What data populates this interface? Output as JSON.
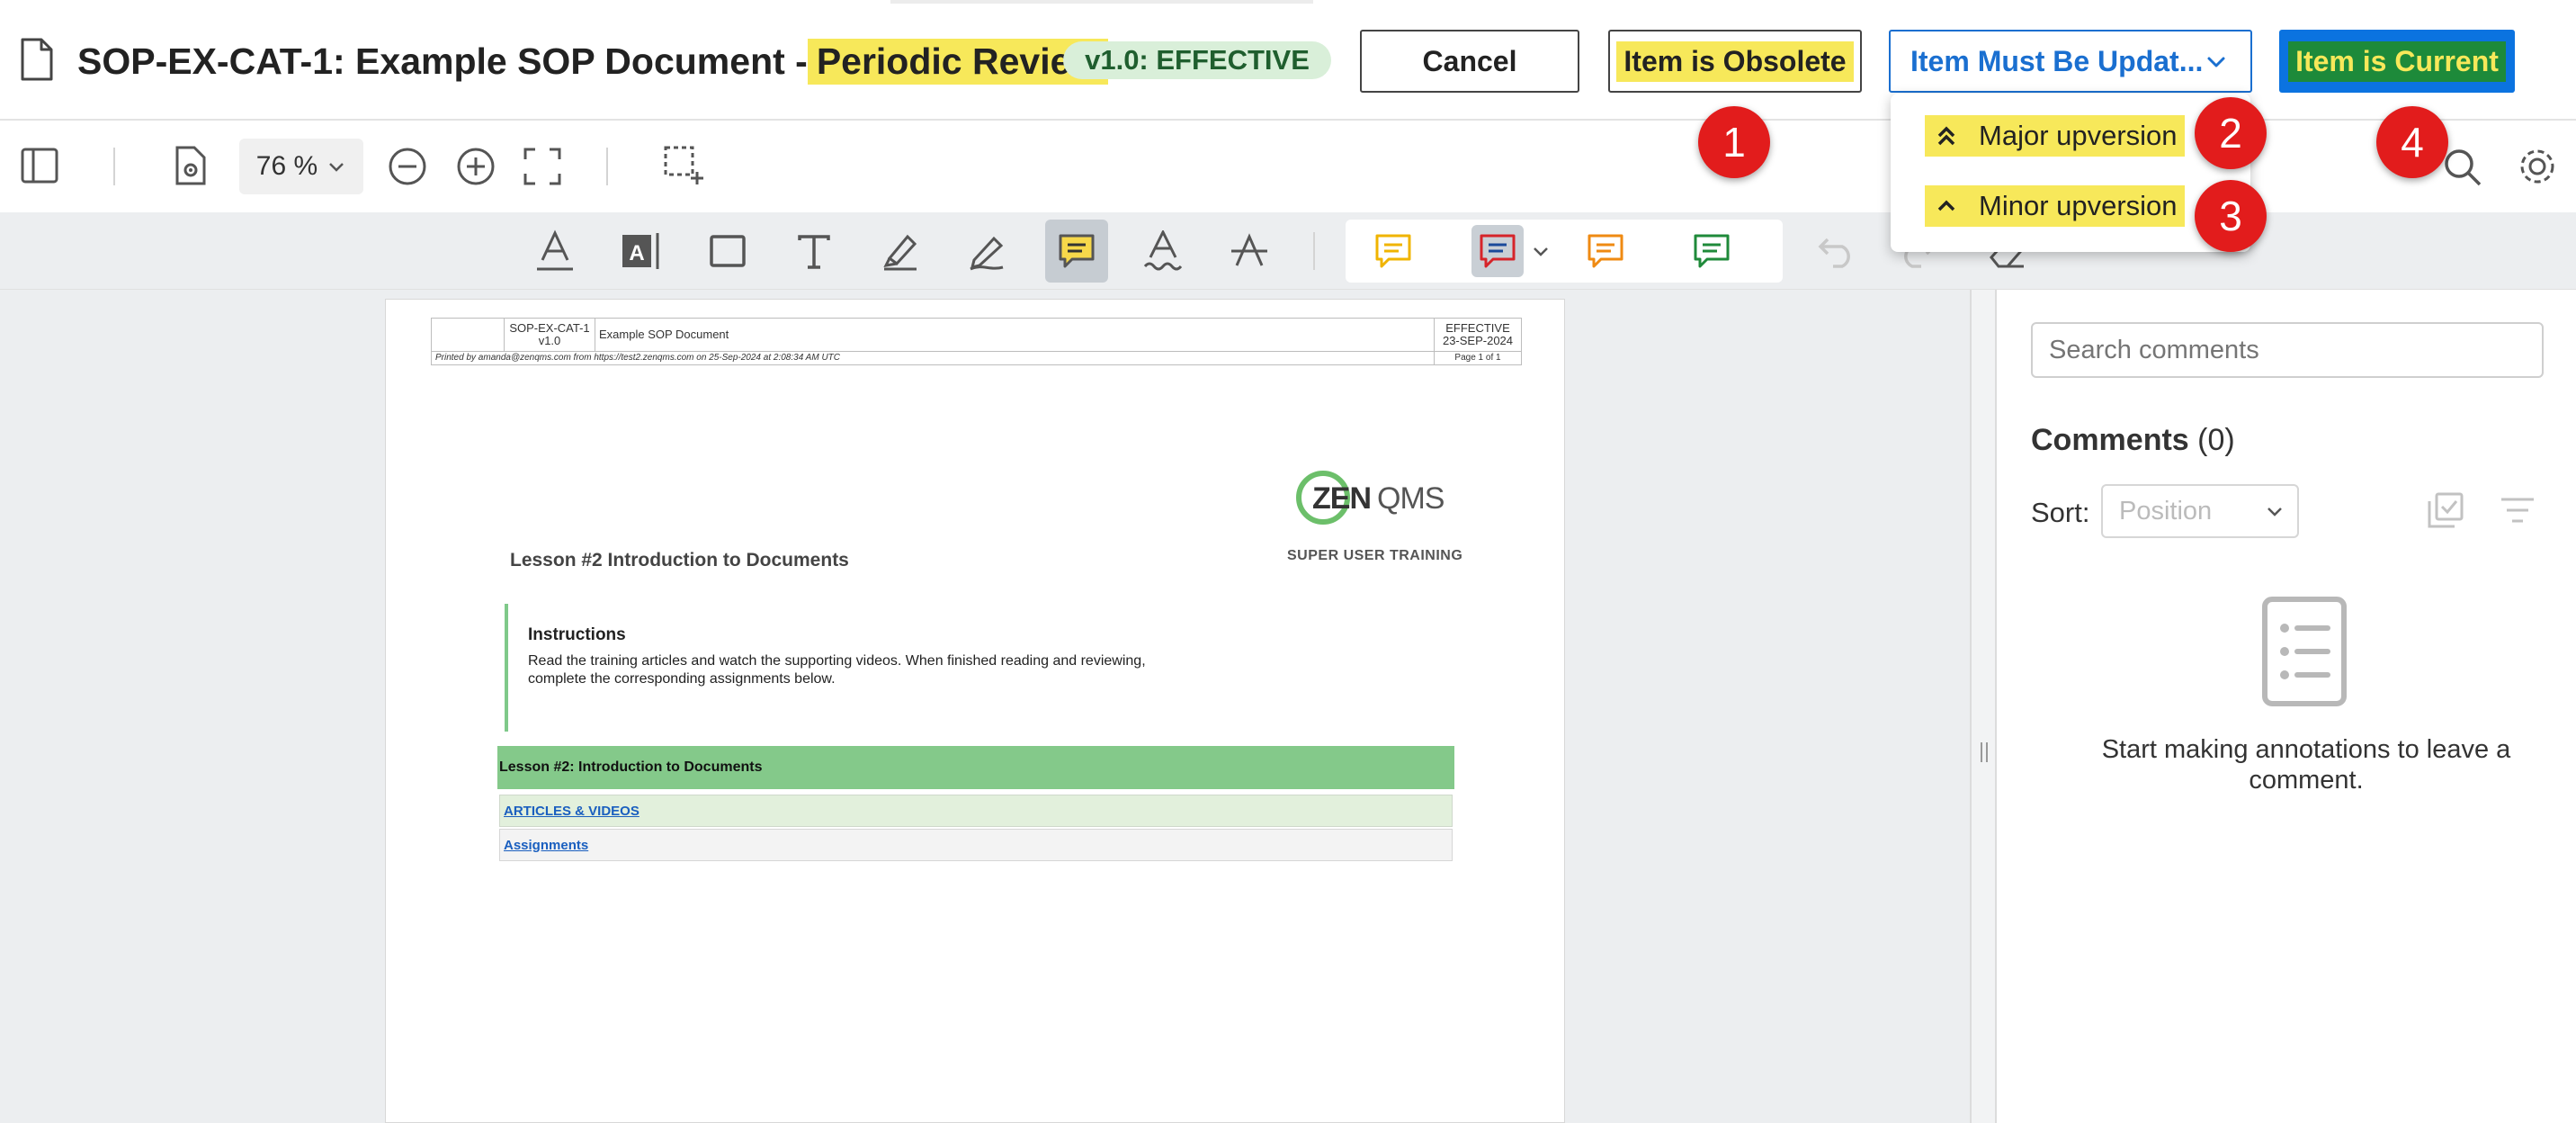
{
  "header": {
    "title_prefix": "SOP-EX-CAT-1: Example SOP Document - ",
    "title_highlight": "Periodic Review",
    "status_badge": "v1.0: EFFECTIVE",
    "cancel_label": "Cancel",
    "obsolete_label": "Item is Obsolete",
    "update_label": "Item Must Be Updat...",
    "current_label": "Item is Current"
  },
  "update_menu": {
    "items": [
      {
        "label": "Major upversion",
        "icon": "double-chevron-up-icon"
      },
      {
        "label": "Minor upversion",
        "icon": "chevron-up-icon"
      }
    ]
  },
  "markers": [
    "1",
    "2",
    "3",
    "4"
  ],
  "toolbar": {
    "zoom": "76 %",
    "tools": [
      "underline-text-icon",
      "text-box-icon",
      "rectangle-icon",
      "text-icon",
      "highlighter-icon",
      "pen-icon",
      "comment-note-icon",
      "squiggly-icon",
      "strikethrough-icon"
    ],
    "comment_tools": [
      "comment-yellow-icon",
      "comment-red-icon",
      "comment-orange-icon",
      "comment-green-icon"
    ],
    "colors": {
      "accent": "#0b73e0",
      "highlight": "#f7e85a",
      "marker": "#e21c1c",
      "green_bar": "#84c98a"
    }
  },
  "pdf": {
    "doc_id": "SOP-EX-CAT-1",
    "version": "v1.0",
    "doc_name": "Example SOP Document",
    "status": "EFFECTIVE",
    "date": "23-SEP-2024",
    "printed_by": "Printed by amanda@zenqms.com from https://test2.zenqms.com on 25-Sep-2024 at 2:08:34 AM UTC",
    "page": "Page 1 of 1",
    "lesson_heading": "Lesson #2 Introduction to Documents",
    "logo_text": "ZENQMS",
    "training_label": "SUPER USER TRAINING",
    "instructions_title": "Instructions",
    "instructions_text": "Read the training articles and watch the supporting videos. When finished reading and reviewing, complete the corresponding assignments below.",
    "lesson_bar": "Lesson #2: Introduction to Documents",
    "link_articles": "ARTICLES & VIDEOS",
    "link_assignments": "Assignments"
  },
  "side_panel": {
    "search_placeholder": "Search comments",
    "comments_label": "Comments",
    "comments_count": "(0)",
    "sort_label": "Sort:",
    "sort_value": "Position",
    "empty_text": "Start making annotations to leave a comment."
  }
}
